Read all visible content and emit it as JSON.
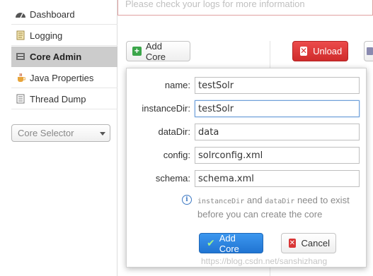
{
  "sidebar": {
    "items": [
      {
        "label": "Dashboard",
        "icon": "dashboard-icon"
      },
      {
        "label": "Logging",
        "icon": "logging-icon"
      },
      {
        "label": "Core Admin",
        "icon": "core-admin-icon",
        "active": true
      },
      {
        "label": "Java Properties",
        "icon": "java-icon"
      },
      {
        "label": "Thread Dump",
        "icon": "thread-dump-icon"
      }
    ],
    "core_selector_placeholder": "Core Selector"
  },
  "log_message": "Please check your logs for more information",
  "toolbar": {
    "add_core_label": "Add Core",
    "unload_label": "Unload"
  },
  "popup": {
    "fields": [
      {
        "label": "name:",
        "value": "testSolr"
      },
      {
        "label": "instanceDir:",
        "value": "testSolr"
      },
      {
        "label": "dataDir:",
        "value": "data"
      },
      {
        "label": "config:",
        "value": "solrconfig.xml"
      },
      {
        "label": "schema:",
        "value": "schema.xml"
      }
    ],
    "hint": {
      "code1": "instanceDir",
      "and": "and",
      "code2": "dataDir",
      "rest1": "need to exist",
      "line2": "before you can create the core"
    },
    "add_core_label": "Add Core",
    "cancel_label": "Cancel"
  },
  "watermark": "https://blog.csdn.net/sanshizhang",
  "colors": {
    "unload_red": "#d93636",
    "add_core_blue": "#2a82df",
    "sidebar_active": "#cccccc"
  }
}
